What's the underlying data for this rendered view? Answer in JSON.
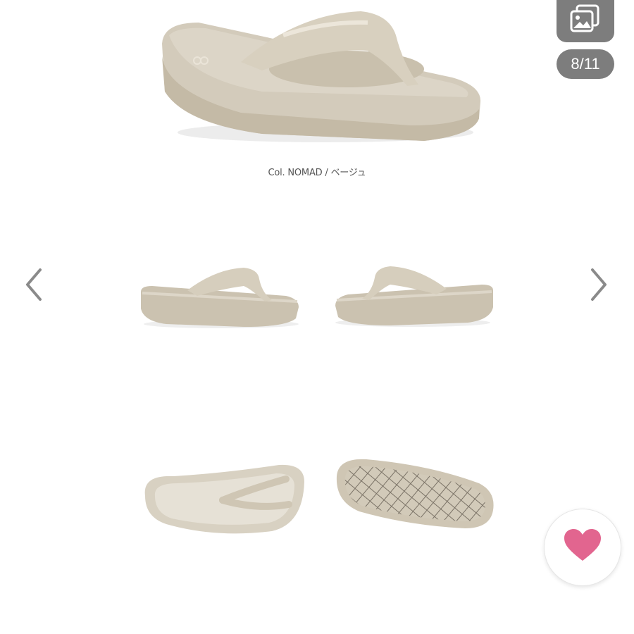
{
  "viewer": {
    "caption": "Col. NOMAD / ベージュ",
    "counter": "8/11",
    "icons": {
      "gallery": "gallery-icon",
      "prev": "chevron-left-icon",
      "next": "chevron-right-icon",
      "like": "heart-icon"
    },
    "colors": {
      "overlay": "#7d7d7d",
      "heart": "#e2658f",
      "product": "#cfc6b4"
    }
  }
}
